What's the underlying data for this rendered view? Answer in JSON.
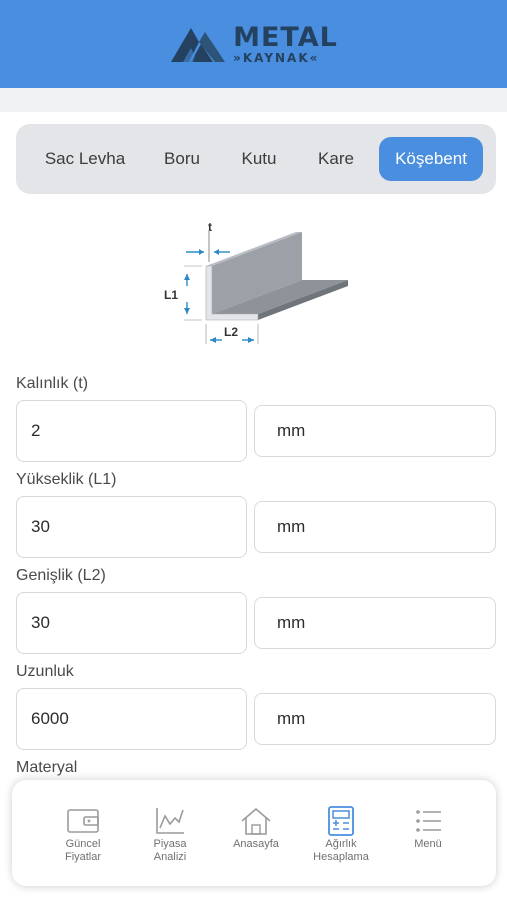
{
  "header": {
    "brand_top": "METAL",
    "brand_bottom": "»KAYNAK«",
    "brand_color": "#24415f",
    "background": "#4a8ee0"
  },
  "tabs": [
    {
      "label": "Sac Levha",
      "active": false
    },
    {
      "label": "Boru",
      "active": false
    },
    {
      "label": "Kutu",
      "active": false
    },
    {
      "label": "Kare",
      "active": false
    },
    {
      "label": "Köşebent",
      "active": true
    }
  ],
  "diagram": {
    "icon": "angle-profile-icon",
    "labels": {
      "t": "t",
      "l1": "L1",
      "l2": "L2"
    }
  },
  "form": {
    "fields": [
      {
        "label": "Kalınlık (t)",
        "value": "2",
        "unit": "mm"
      },
      {
        "label": "Yükseklik (L1)",
        "value": "30",
        "unit": "mm"
      },
      {
        "label": "Genişlik (L2)",
        "value": "30",
        "unit": "mm"
      },
      {
        "label": "Uzunluk",
        "value": "6000",
        "unit": "mm"
      }
    ],
    "material_label": "Materyal"
  },
  "bottom_nav": [
    {
      "line1": "Güncel",
      "line2": "Fiyatlar",
      "icon": "wallet-icon",
      "active": false
    },
    {
      "line1": "Piyasa",
      "line2": "Analizi",
      "icon": "chart-icon",
      "active": false
    },
    {
      "line1": "Anasayfa",
      "line2": "",
      "icon": "home-icon",
      "active": false
    },
    {
      "line1": "Ağırlık",
      "line2": "Hesaplama",
      "icon": "calculator-icon",
      "active": true
    },
    {
      "line1": "Menü",
      "line2": "",
      "icon": "menu-icon",
      "active": false
    }
  ],
  "colors": {
    "accent": "#4a8ee0",
    "tab_bar_bg": "#e4e5e8",
    "nav_icon_active": "#4a8ee0",
    "nav_icon_inactive": "#9a9a9a"
  }
}
